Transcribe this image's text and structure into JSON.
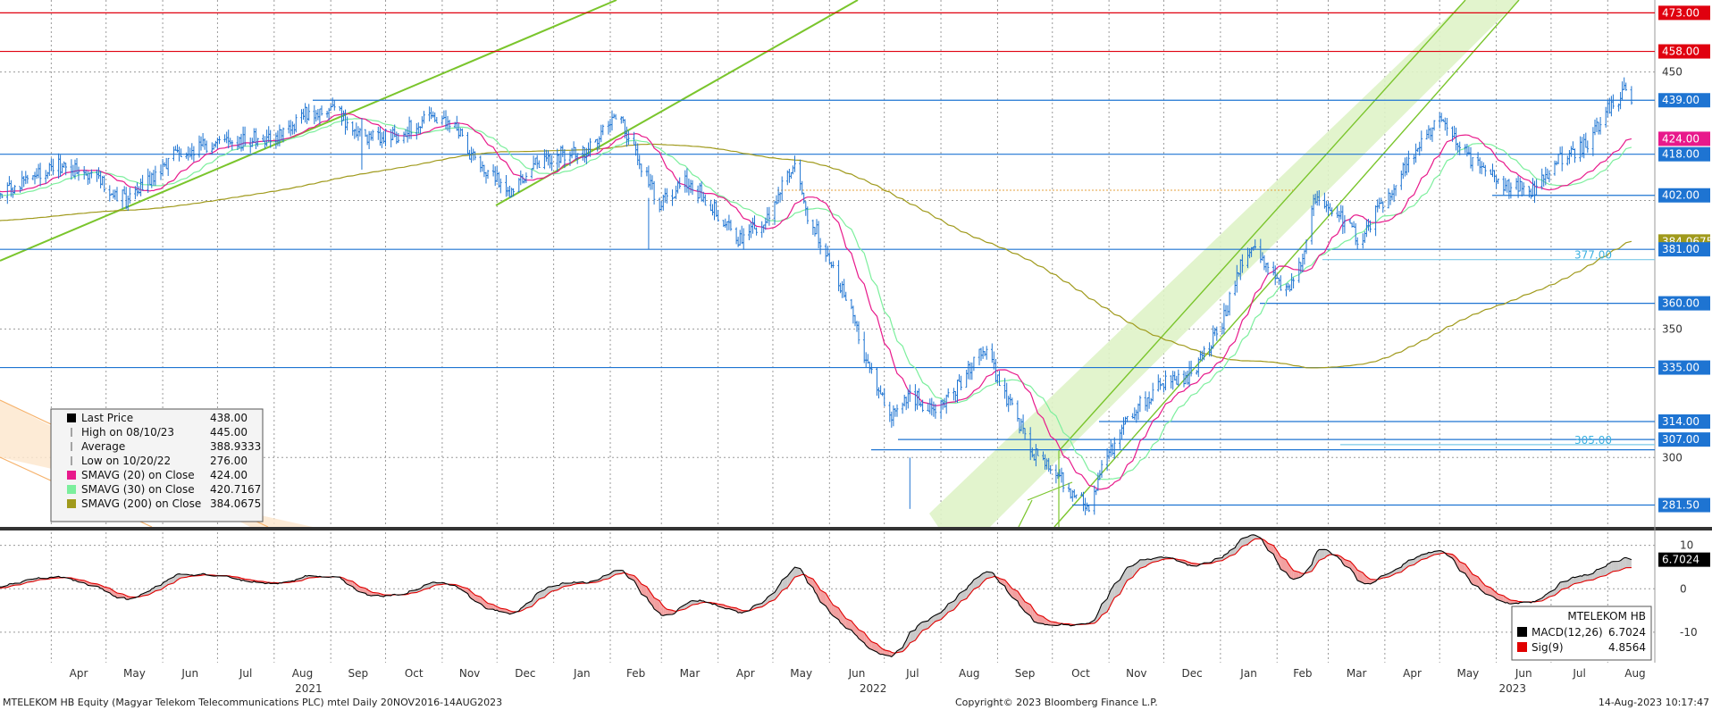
{
  "footer": {
    "left": "MTELEKOM HB Equity (Magyar Telekom Telecommunications PLC) mtel  Daily 20NOV2016-14AUG2023",
    "center": "Copyright© 2023 Bloomberg Finance L.P.",
    "right": "14-Aug-2023 10:17:47"
  },
  "legend_main": {
    "items": [
      {
        "label": "Last Price",
        "value": "438.00",
        "color": "#000000",
        "marker": "square"
      },
      {
        "label": "High on 08/10/23",
        "value": "445.00",
        "color": "#555555",
        "marker": "high"
      },
      {
        "label": "Average",
        "value": "388.9333",
        "color": "#555555",
        "marker": "avg"
      },
      {
        "label": "Low on 10/20/22",
        "value": "276.00",
        "color": "#555555",
        "marker": "low"
      },
      {
        "label": "SMAVG (20)  on Close",
        "value": "424.00",
        "color": "#e8198b",
        "marker": "square"
      },
      {
        "label": "SMAVG (30)  on Close",
        "value": "420.7167",
        "color": "#7cef9d",
        "marker": "square"
      },
      {
        "label": "SMAVG (200)  on Close",
        "value": "384.0675",
        "color": "#a09a1c",
        "marker": "square"
      }
    ]
  },
  "legend_macd": {
    "title": "MTELEKOM HB",
    "items": [
      {
        "label": "MACD(12,26)",
        "value": "6.7024",
        "color": "#000000"
      },
      {
        "label": "Sig(9)",
        "value": "4.8564",
        "color": "#e00000"
      }
    ]
  },
  "price_axis": {
    "ticks": [
      "450",
      "350",
      "300"
    ],
    "level_labels": [
      {
        "value": 473,
        "text": "473.00",
        "bg": "#e0000f"
      },
      {
        "value": 458,
        "text": "458.00",
        "bg": "#e0000f"
      },
      {
        "value": 439,
        "text": "439.00",
        "bg": "#1e74d2"
      },
      {
        "value": 424,
        "text": "424.00",
        "bg": "#e8198b"
      },
      {
        "value": 418,
        "text": "418.00",
        "bg": "#1e74d2"
      },
      {
        "value": 402,
        "text": "402.00",
        "bg": "#1e74d2"
      },
      {
        "value": 384.0675,
        "text": "384.0675",
        "bg": "#a09a1c"
      },
      {
        "value": 381,
        "text": "381.00",
        "bg": "#1e74d2"
      },
      {
        "value": 360,
        "text": "360.00",
        "bg": "#1e74d2"
      },
      {
        "value": 335,
        "text": "335.00",
        "bg": "#1e74d2"
      },
      {
        "value": 314,
        "text": "314.00",
        "bg": "#1e74d2"
      },
      {
        "value": 307,
        "text": "307.00",
        "bg": "#1e74d2"
      },
      {
        "value": 281.5,
        "text": "281.50",
        "bg": "#1e74d2"
      }
    ],
    "inline_labels": [
      {
        "value": 377,
        "text": "377.00"
      },
      {
        "value": 305,
        "text": "305.00"
      }
    ]
  },
  "macd_axis": {
    "ticks": [
      "10",
      "0",
      "-10"
    ],
    "last_label": "6.7024",
    "sig_label": "4.8564"
  },
  "time_axis": {
    "months": [
      "Apr",
      "May",
      "Jun",
      "Jul",
      "Aug",
      "Sep",
      "Oct",
      "Nov",
      "Dec",
      "Jan",
      "Feb",
      "Mar",
      "Apr",
      "May",
      "Jun",
      "Jul",
      "Aug",
      "Sep",
      "Oct",
      "Nov",
      "Dec",
      "Jan",
      "Feb",
      "Mar",
      "Apr",
      "May",
      "Jun",
      "Jul",
      "Aug"
    ],
    "years": [
      "2021",
      "2022",
      "2023"
    ]
  },
  "colors": {
    "price_bars": "#1e74d2",
    "sma20": "#e8198b",
    "sma30": "#7cef9d",
    "sma200": "#a09a1c",
    "resistance": "#e0000f",
    "support": "#1e74d2",
    "trend": "#7ac52c",
    "channel_fill": "#dff3c8",
    "macd": "#000000",
    "signal": "#e00000"
  },
  "chart_data": [
    {
      "type": "line",
      "subtype": "ohlc",
      "series": [
        {
          "name": "Last Price",
          "color": "#1e74d2",
          "anchors": [
            [
              "2021-03-05",
              402
            ],
            [
              "2021-03-20",
              410
            ],
            [
              "2021-04-05",
              414
            ],
            [
              "2021-04-25",
              409
            ],
            [
              "2021-05-12",
              400
            ],
            [
              "2021-05-28",
              410
            ],
            [
              "2021-06-12",
              420
            ],
            [
              "2021-07-01",
              422
            ],
            [
              "2021-07-20",
              424
            ],
            [
              "2021-08-05",
              426
            ],
            [
              "2021-08-20",
              435
            ],
            [
              "2021-09-05",
              434
            ],
            [
              "2021-09-20",
              424
            ],
            [
              "2021-10-05",
              425
            ],
            [
              "2021-10-25",
              432
            ],
            [
              "2021-11-08",
              428
            ],
            [
              "2021-11-22",
              412
            ],
            [
              "2021-12-08",
              404
            ],
            [
              "2021-12-20",
              414
            ],
            [
              "2022-01-05",
              418
            ],
            [
              "2022-01-20",
              420
            ],
            [
              "2022-02-05",
              434
            ],
            [
              "2022-02-15",
              418
            ],
            [
              "2022-02-28",
              398
            ],
            [
              "2022-03-15",
              408
            ],
            [
              "2022-03-31",
              396
            ],
            [
              "2022-04-12",
              385
            ],
            [
              "2022-04-28",
              392
            ],
            [
              "2022-05-12",
              415
            ],
            [
              "2022-05-20",
              395
            ],
            [
              "2022-06-01",
              378
            ],
            [
              "2022-06-12",
              358
            ],
            [
              "2022-06-25",
              330
            ],
            [
              "2022-07-05",
              315
            ],
            [
              "2022-07-15",
              325
            ],
            [
              "2022-07-28",
              318
            ],
            [
              "2022-08-10",
              328
            ],
            [
              "2022-08-25",
              342
            ],
            [
              "2022-09-05",
              325
            ],
            [
              "2022-09-20",
              302
            ],
            [
              "2022-10-05",
              292
            ],
            [
              "2022-10-20",
              280
            ],
            [
              "2022-11-01",
              302
            ],
            [
              "2022-11-15",
              318
            ],
            [
              "2022-12-01",
              330
            ],
            [
              "2022-12-15",
              332
            ],
            [
              "2023-01-01",
              350
            ],
            [
              "2023-01-15",
              382
            ],
            [
              "2023-01-25",
              377
            ],
            [
              "2023-02-05",
              365
            ],
            [
              "2023-02-15",
              375
            ],
            [
              "2023-02-22",
              402
            ],
            [
              "2023-03-05",
              395
            ],
            [
              "2023-03-18",
              385
            ],
            [
              "2023-04-01",
              400
            ],
            [
              "2023-04-20",
              422
            ],
            [
              "2023-05-01",
              432
            ],
            [
              "2023-05-12",
              420
            ],
            [
              "2023-05-25",
              412
            ],
            [
              "2023-06-08",
              405
            ],
            [
              "2023-06-22",
              404
            ],
            [
              "2023-07-05",
              415
            ],
            [
              "2023-07-20",
              422
            ],
            [
              "2023-08-01",
              435
            ],
            [
              "2023-08-10",
              442
            ],
            [
              "2023-08-14",
              438
            ]
          ]
        },
        {
          "name": "SMAVG (20)  on Close",
          "color": "#e8198b",
          "last": 424.0
        },
        {
          "name": "SMAVG (30)  on Close",
          "color": "#7cef9d",
          "last": 420.7167
        },
        {
          "name": "SMAVG (200)  on Close",
          "color": "#a09a1c",
          "last": 384.0675
        }
      ],
      "stats": {
        "last": 438.0,
        "high": 445.0,
        "high_date": "2023-08-10",
        "low": 276.0,
        "low_date": "2022-10-20",
        "average": 388.9333
      },
      "horizontal_levels": [
        473,
        458,
        439,
        418,
        402,
        381,
        377,
        360,
        335,
        314,
        307,
        305,
        281.5
      ],
      "x_range": [
        "2021-03-01",
        "2023-08-14"
      ],
      "ylim": [
        273,
        478
      ],
      "grid": true
    },
    {
      "type": "line",
      "series": [
        {
          "name": "MACD(12,26)",
          "color": "#000000",
          "last": 6.7024
        },
        {
          "name": "Sig(9)",
          "color": "#e00000",
          "last": 4.8564
        }
      ],
      "ylim": [
        -17,
        13
      ],
      "grid": true
    }
  ]
}
